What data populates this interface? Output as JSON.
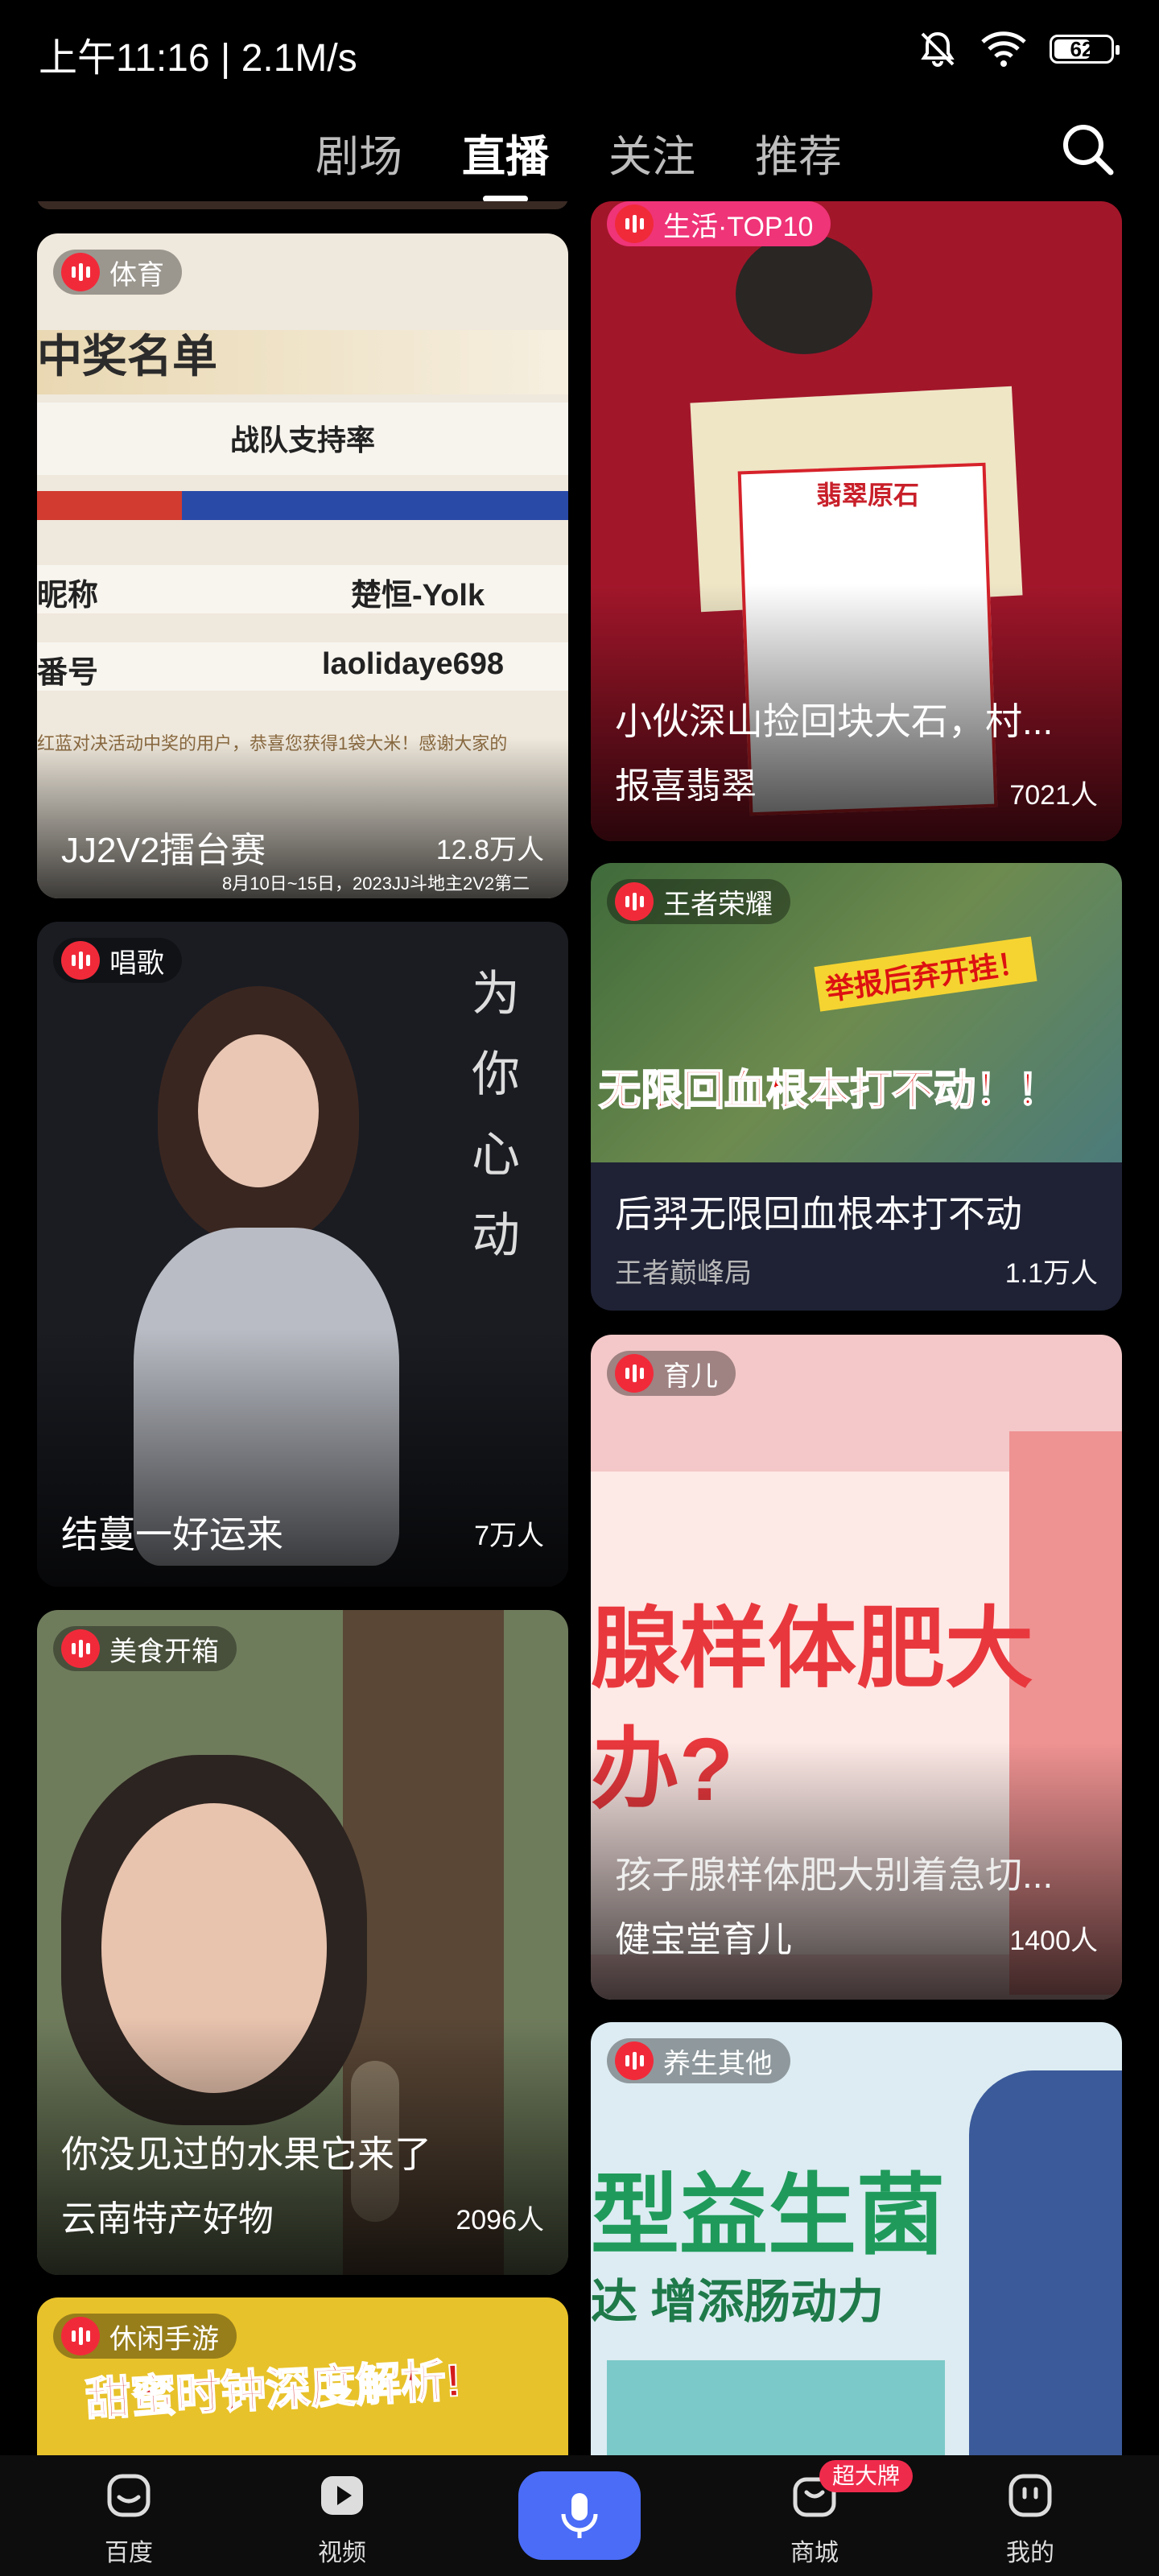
{
  "status_bar": {
    "time": "上午11:16 | 2.1M/s",
    "battery": "62"
  },
  "tabs": [
    "剧场",
    "直播",
    "关注",
    "推荐"
  ],
  "active_tab": "直播",
  "cards": {
    "c1": {
      "category": "体育",
      "overlay_title": "中奖名单",
      "overlay_sub": "战队支持率",
      "row1_label": "昵称",
      "row1_value": "楚恒-Yolk",
      "row2_label": "番号",
      "row2_value": "laolidaye698",
      "notice": "红蓝对决活动中奖的用户，恭喜您获得1袋大米！感谢大家的",
      "title": "JJ2V2擂台赛",
      "viewers": "12.8万人",
      "footer": "8月10日~15日，2023JJ斗地主2V2第二"
    },
    "c2": {
      "category": "生活·TOP10",
      "title": "小伙深山捡回块大石，村...",
      "subtitle": "报喜翡翠",
      "viewers": "7021人",
      "tag_text": "翡翠原石"
    },
    "c3": {
      "category": "唱歌",
      "poem": "为你心动",
      "title": "结蔓一好运来",
      "viewers": "7万人"
    },
    "c4": {
      "category": "王者荣耀",
      "banner": "无限回血根本打不动！！",
      "banner2": "举报后弃开挂！",
      "title": "后羿无限回血根本打不动",
      "subtitle": "王者巅峰局",
      "viewers": "1.1万人"
    },
    "c5": {
      "category": "育儿",
      "big_text": "腺样体肥大",
      "big_text2": "办?",
      "title": "孩子腺样体肥大别着急切...",
      "subtitle": "健宝堂育儿",
      "viewers": "1400人"
    },
    "c6": {
      "category": "美食开箱",
      "title": "你没见过的水果它来了",
      "subtitle": "云南特产好物",
      "viewers": "2096人"
    },
    "c7": {
      "category": "养生其他",
      "big_text": "型益生菌",
      "big_text2": "达 增添肠动力"
    },
    "c8": {
      "category": "休闲手游",
      "banner": "甜蜜时钟深度解析!"
    }
  },
  "nav": {
    "items": [
      "百度",
      "视频",
      "商城",
      "我的"
    ],
    "badge": "超大牌"
  },
  "colors": {
    "accent": "#4a6cf7",
    "live_red": "#f12a3a",
    "badge": "#ef2b4c"
  }
}
